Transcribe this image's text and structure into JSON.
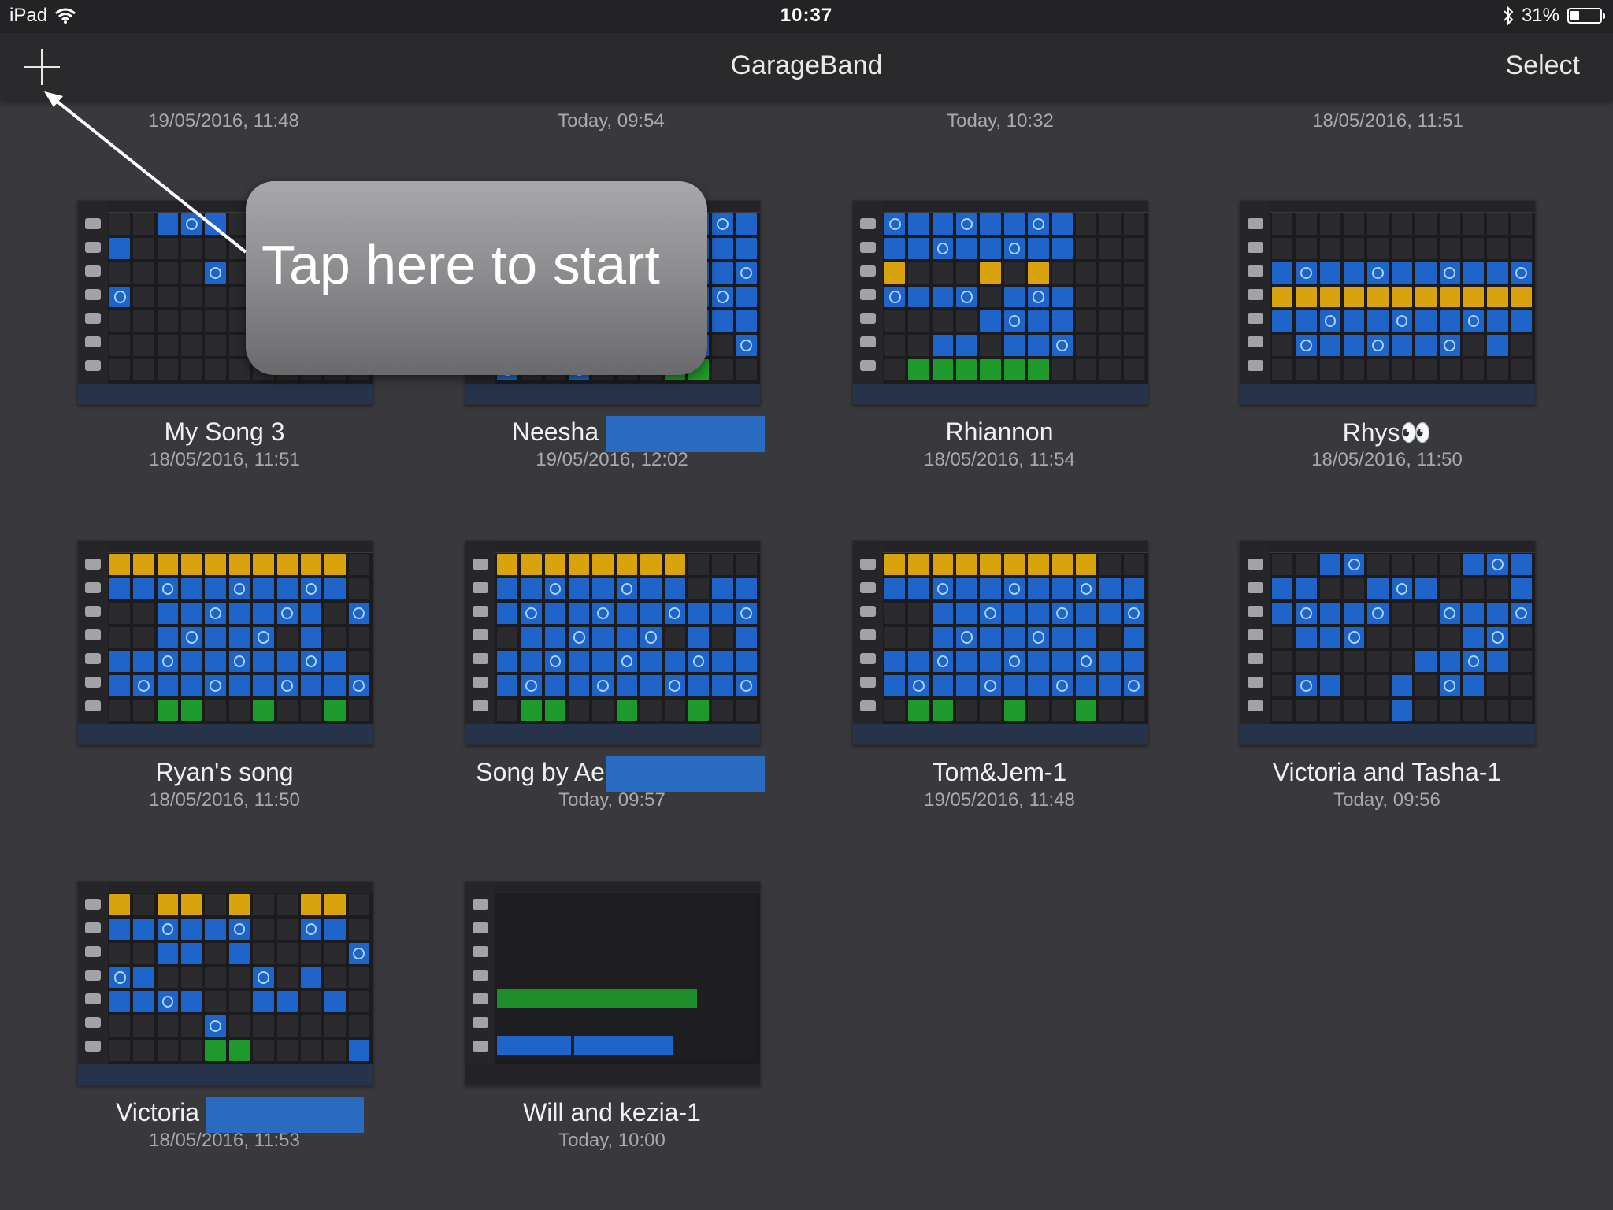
{
  "status_bar": {
    "device": "iPad",
    "time": "10:37",
    "battery": "31%",
    "battery_level": 0.31,
    "icons": [
      "wifi-icon",
      "bluetooth-icon",
      "battery-icon"
    ]
  },
  "nav": {
    "title": "GarageBand",
    "select_label": "Select",
    "add_icon": "plus-icon"
  },
  "tooltip": {
    "text": "Tap here to start"
  },
  "previous_row": [
    {
      "date": "19/05/2016, 11:48"
    },
    {
      "date": "Today, 09:54"
    },
    {
      "date": "Today, 10:32"
    },
    {
      "date": "18/05/2016, 11:51"
    }
  ],
  "songs": [
    {
      "name": "My Song 3",
      "date": "18/05/2016, 11:51"
    },
    {
      "name": "Neesha",
      "date": "19/05/2016, 12:02"
    },
    {
      "name": "Rhiannon",
      "date": "18/05/2016, 11:54"
    },
    {
      "name": "Rhys👀",
      "date": "18/05/2016, 11:50"
    },
    {
      "name": "Ryan's song",
      "date": "18/05/2016, 11:50"
    },
    {
      "name": "Song by Ae..",
      "date": "Today, 09:57"
    },
    {
      "name": "Tom&Jem-1",
      "date": "19/05/2016, 11:48"
    },
    {
      "name": "Victoria and Tasha-1",
      "date": "Today, 09:56"
    },
    {
      "name": "Victoria",
      "date": "18/05/2016, 11:53"
    },
    {
      "name": "Will and kezia-1",
      "date": "Today, 10:00"
    }
  ],
  "colors": {
    "background": "#39393d",
    "navbar": "#2a2a2c",
    "cell_blue": "#1f64c8",
    "cell_yellow": "#d9a30d",
    "cell_green": "#1e9a2c",
    "redaction": "#2a6bc2"
  }
}
